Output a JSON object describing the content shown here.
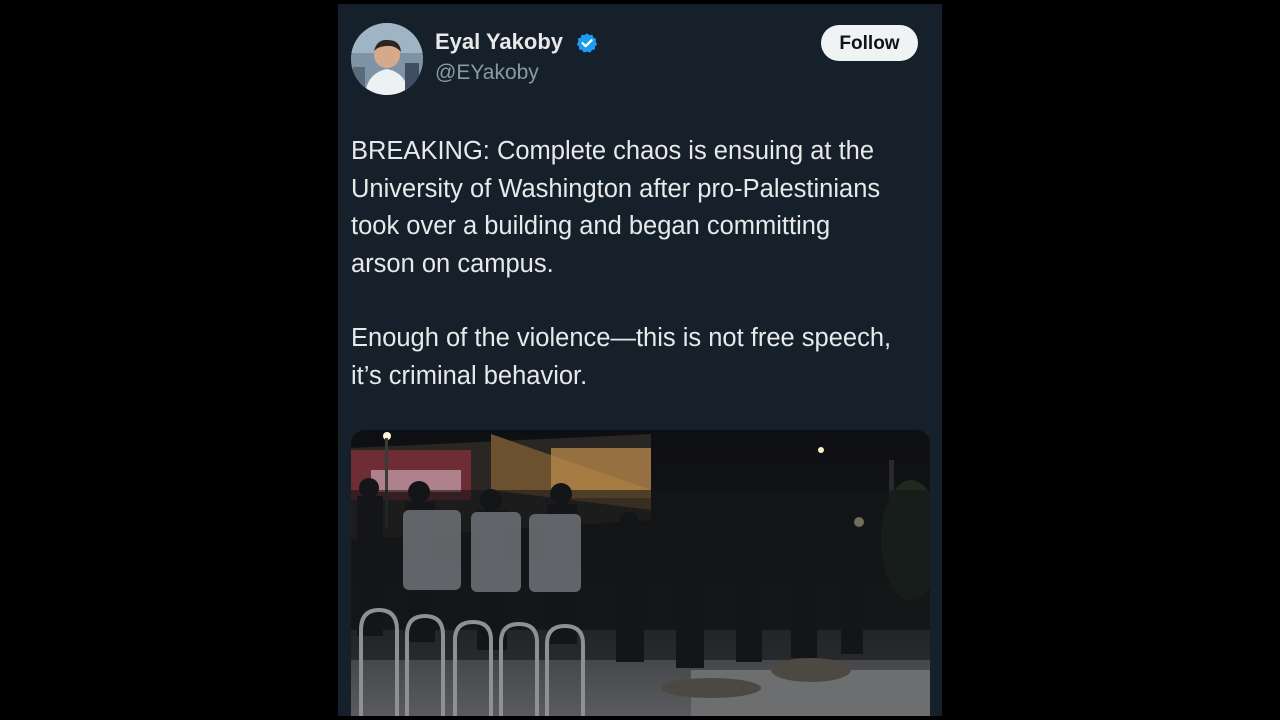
{
  "tweet": {
    "author": {
      "display_name": "Eyal Yakoby",
      "handle": "@EYakoby",
      "verified": true
    },
    "follow_label": "Follow",
    "paragraphs": [
      "BREAKING: Complete chaos is ensuing at the\nUniversity of Washington after pro-Palestinians\ntook over a building and began committing\narson on campus.",
      "Enough of the violence—this is not free speech,\nit’s criminal behavior."
    ],
    "media": {
      "kind": "photo"
    }
  },
  "colors": {
    "page_background": "#000000",
    "card_background": "#15202b",
    "primary_text": "#e7e9ea",
    "secondary_text": "#8b98a5",
    "verified_blue": "#1d9bf0",
    "follow_button_bg": "#eff3f4"
  },
  "icons": {
    "verified": "verified-badge-icon"
  }
}
